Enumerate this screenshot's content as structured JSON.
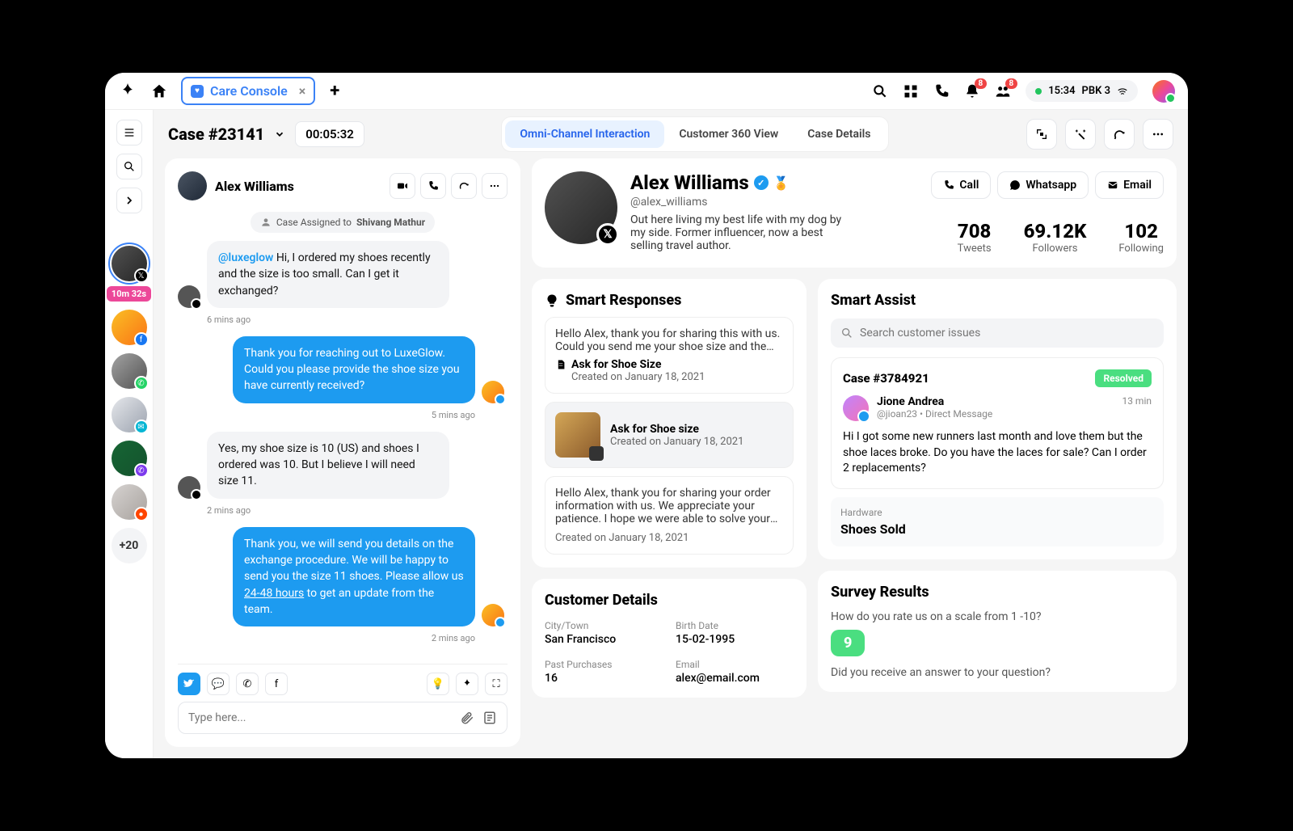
{
  "topbar": {
    "tab_label": "Care Console",
    "time": "15:34",
    "status_label": "PBK 3",
    "notif_badge": "8",
    "people_badge": "8"
  },
  "sidebar": {
    "active_timer": "10m 32s",
    "more_count": "+20",
    "platforms": [
      "x",
      "facebook",
      "whatsapp",
      "twitter",
      "viber",
      "reddit"
    ]
  },
  "header": {
    "case_title": "Case #23141",
    "elapsed": "00:05:32",
    "tabs": [
      "Omni-Channel Interaction",
      "Customer 360 View",
      "Case Details"
    ]
  },
  "chat": {
    "contact_name": "Alex Williams",
    "assigned_prefix": "Case Assigned to ",
    "assigned_to": "Shivang Mathur",
    "mention": "@luxeglow",
    "m1": " Hi, I ordered my shoes recently and the size is too small. Can I get it exchanged?",
    "t1": "6 mins ago",
    "m2": "Thank you for reaching out to LuxeGlow. Could you please provide the shoe size you have currently received?",
    "t2": "5 mins ago",
    "m3": "Yes, my shoe size is 10 (US) and shoes I ordered was 10. But I believe I will need size 11.",
    "t3": "2 mins ago",
    "m4_a": "Thank you, we will send you details on the exchange procedure. We will be happy to send you the size 11 shoes. Please allow us ",
    "m4_u": "24-48 hours",
    "m4_b": " to get an update from the team.",
    "t4": "2 mins ago",
    "placeholder": "Type here..."
  },
  "profile": {
    "name": "Alex Williams",
    "handle": "@alex_williams",
    "bio": "Out here living my best life with my dog by my side. Former influencer, now a best selling travel author.",
    "actions": {
      "call": "Call",
      "whatsapp": "Whatsapp",
      "email": "Email"
    },
    "stats": {
      "tweets_n": "708",
      "tweets_l": "Tweets",
      "followers_n": "69.12K",
      "followers_l": "Followers",
      "following_n": "102",
      "following_l": "Following"
    }
  },
  "smart_responses": {
    "title": "Smart Responses",
    "r1_body": "Hello Alex, thank you for sharing this with us. Could you send me your shoe size and the c...",
    "r1_title": "Ask for Shoe Size",
    "r1_meta": "Created on January 18, 2021",
    "r2_title": "Ask for Shoe size",
    "r2_meta": "Created on January 18, 2021",
    "r3_body": "Hello Alex, thank you for sharing your order information with us. We appreciate your patience. I hope we were able to solve your i...",
    "r3_meta": "Created on January 18, 2021"
  },
  "customer_details": {
    "title": "Customer Details",
    "city_l": "City/Town",
    "city_v": "San Francisco",
    "birth_l": "Birth Date",
    "birth_v": "15-02-1995",
    "purch_l": "Past Purchases",
    "purch_v": "16",
    "email_l": "Email",
    "email_v": "alex@email.com"
  },
  "smart_assist": {
    "title": "Smart Assist",
    "search_ph": "Search customer issues",
    "case_id": "Case #3784921",
    "status": "Resolved",
    "user_name": "Jione Andrea",
    "user_handle": "@jioan23 • Direct Message",
    "time": "13 min",
    "msg": "Hi I got some new runners last month and love them but the shoe laces broke. Do you have the laces for sale? Can I order 2 replacements?",
    "hw_l": "Hardware",
    "hw_v": "Shoes Sold"
  },
  "survey": {
    "title": "Survey Results",
    "q1": "How do you rate us on a scale from 1 -10?",
    "score": "9",
    "q2": "Did you receive an answer to your question?"
  }
}
